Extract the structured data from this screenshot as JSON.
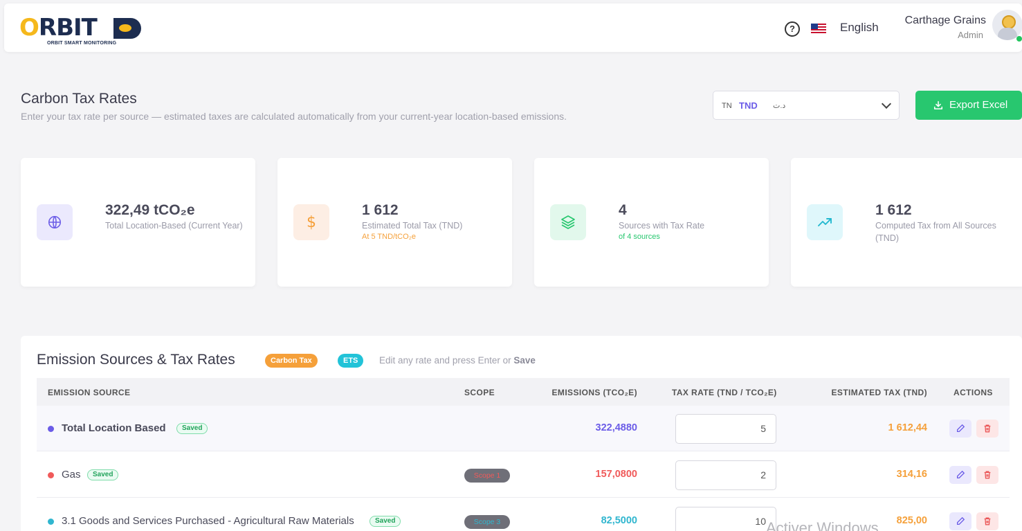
{
  "header": {
    "logo_text": "RBIT",
    "logo_sub": "ORBIT SMART MONITORING",
    "language": "English",
    "user_name": "Carthage Grains",
    "user_role": "Admin"
  },
  "page": {
    "title": "Carbon Tax Rates",
    "subtitle": "Enter your tax rate per source — estimated taxes are calculated automatically from your current-year location-based emissions."
  },
  "currency": {
    "country": "TN",
    "code": "TND",
    "symbol": "د.ت"
  },
  "export_label": "Export Excel",
  "cards": [
    {
      "value": "322,49 tCO₂e",
      "label": "Total Location-Based (Current Year)",
      "note": ""
    },
    {
      "value": "1 612",
      "label": "Estimated Total Tax (TND)",
      "note": "At 5 TND/tCO₂e"
    },
    {
      "value": "4",
      "label": "Sources with Tax Rate",
      "note": "of 4 sources"
    },
    {
      "value": "1 612",
      "label": "Computed Tax from All Sources (TND)",
      "note": ""
    }
  ],
  "table": {
    "title": "Emission Sources & Tax Rates",
    "badge_carbon": "Carbon Tax",
    "badge_ets": "ETS",
    "hint_prefix": "Edit any rate and press Enter or",
    "hint_save": "Save",
    "headers": {
      "source": "EMISSION SOURCE",
      "scope": "SCOPE",
      "emissions": "EMISSIONS (TCO₂E)",
      "rate": "TAX RATE (TND / TCO₂E)",
      "estimated": "ESTIMATED TAX (TND)",
      "actions": "ACTIONS"
    },
    "rows": [
      {
        "name": "Total Location Based",
        "status": "Saved",
        "scope": "",
        "emissions": "322,4880",
        "rate": "5",
        "estimated": "1 612,44"
      },
      {
        "name": "Gas",
        "status": "Saved",
        "scope": "Scope 1",
        "emissions": "157,0800",
        "rate": "2",
        "estimated": "314,16"
      },
      {
        "name": "3.1 Goods and Services Purchased - Agricultural Raw Materials",
        "status": "Saved",
        "scope": "Scope 3",
        "emissions": "82,5000",
        "rate": "10",
        "estimated": "825,00"
      }
    ]
  },
  "watermark": "Activer Windows",
  "colors": {
    "accent": "#6b5ce7",
    "success": "#28c76f",
    "warning": "#f5a03a",
    "scope1": "#f05a5a",
    "scope3": "#30b6cf"
  }
}
